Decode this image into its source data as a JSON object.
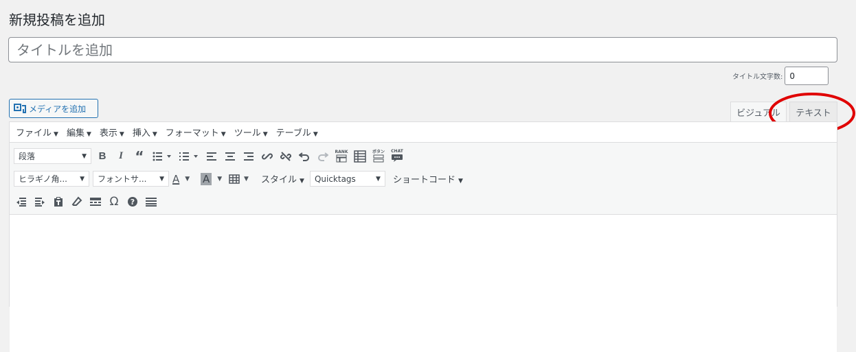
{
  "page": {
    "title": "新規投稿を追加"
  },
  "title_field": {
    "placeholder": "タイトルを追加",
    "value": ""
  },
  "title_count": {
    "label": "タイトル文字数:",
    "value": "0"
  },
  "media_button": {
    "label": "メディアを追加",
    "icon": "media-icon"
  },
  "tabs": [
    {
      "label": "ビジュアル",
      "active": true
    },
    {
      "label": "テキスト",
      "active": false
    }
  ],
  "annotation": {
    "shape": "ellipse",
    "color": "#e00000",
    "target": "テキスト"
  },
  "menubar": [
    {
      "label": "ファイル"
    },
    {
      "label": "編集"
    },
    {
      "label": "表示"
    },
    {
      "label": "挿入"
    },
    {
      "label": "フォーマット"
    },
    {
      "label": "ツール"
    },
    {
      "label": "テーブル"
    }
  ],
  "toolbar1": {
    "format_select": "段落",
    "icons": [
      "bold-icon",
      "italic-icon",
      "blockquote-icon",
      "bullet-list-icon",
      "numbered-list-icon",
      "align-left-icon",
      "align-center-icon",
      "align-right-icon",
      "link-icon",
      "unlink-icon",
      "undo-icon",
      "redo-icon",
      "rank-icon",
      "table-icon",
      "button-icon",
      "chat-icon"
    ],
    "rank_label": "RANK",
    "button_label": "ボタン",
    "chat_label": "CHAT"
  },
  "toolbar2": {
    "font_family": "ヒラギノ角...",
    "font_size": "フォントサ...",
    "text_color_letter": "A",
    "bg_color_letter": "A",
    "style_label": "スタイル",
    "quicktags": "Quicktags",
    "shortcode_label": "ショートコード"
  },
  "toolbar3": {
    "icons": [
      "outdent-icon",
      "indent-icon",
      "paste-text-icon",
      "clear-format-icon",
      "more-tag-icon",
      "special-char-icon",
      "help-icon",
      "kitchen-sink-icon"
    ],
    "omega": "Ω"
  },
  "colors": {
    "accent": "#2271b1",
    "annotation": "#e00000",
    "background": "#f1f1f1"
  }
}
